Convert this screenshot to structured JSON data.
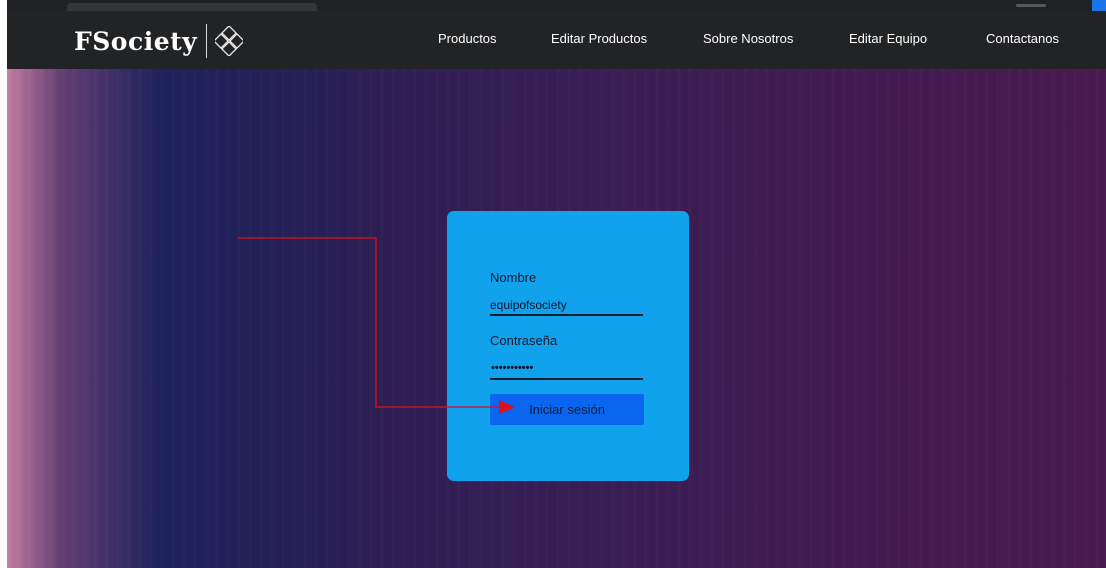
{
  "brand": {
    "name": "FSociety",
    "logo_icon": "diamond-knot-logo"
  },
  "nav": {
    "items": [
      {
        "label": "Productos"
      },
      {
        "label": "Editar Productos"
      },
      {
        "label": "Sobre Nosotros"
      },
      {
        "label": "Editar Equipo"
      },
      {
        "label": "Contactanos"
      }
    ]
  },
  "login": {
    "username_label": "Nombre",
    "username_value": "equipofsociety",
    "password_label": "Contraseña",
    "password_masked": "•••••••••••",
    "submit_label": "Iniciar sesión"
  },
  "colors": {
    "navbar": "#222325",
    "card": "#11a2ee",
    "button": "#0b66ef",
    "annotation_arrow": "#e0101a"
  }
}
